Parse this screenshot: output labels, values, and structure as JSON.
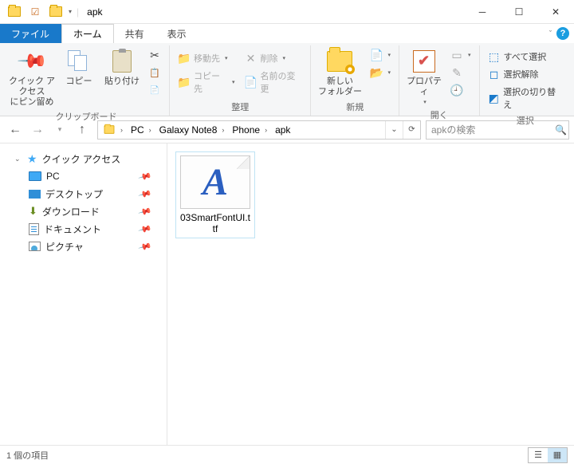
{
  "window": {
    "title": "apk"
  },
  "tabs": {
    "file": "ファイル",
    "home": "ホーム",
    "share": "共有",
    "view": "表示"
  },
  "ribbon": {
    "clipboard": {
      "label": "クリップボード",
      "pin": "クイック アクセス\nにピン留め",
      "copy": "コピー",
      "paste": "貼り付け"
    },
    "organize": {
      "label": "整理",
      "moveto": "移動先",
      "copyto": "コピー先",
      "delete": "削除",
      "rename": "名前の変更"
    },
    "new": {
      "label": "新規",
      "newfolder": "新しい\nフォルダー"
    },
    "open": {
      "label": "開く",
      "properties": "プロパティ"
    },
    "select": {
      "label": "選択",
      "all": "すべて選択",
      "none": "選択解除",
      "invert": "選択の切り替え"
    }
  },
  "breadcrumb": [
    "PC",
    "Galaxy Note8",
    "Phone",
    "apk"
  ],
  "search": {
    "placeholder": "apkの検索"
  },
  "sidebar": {
    "quick": "クイック アクセス",
    "items": [
      {
        "label": "PC"
      },
      {
        "label": "デスクトップ"
      },
      {
        "label": "ダウンロード"
      },
      {
        "label": "ドキュメント"
      },
      {
        "label": "ピクチャ"
      }
    ]
  },
  "files": [
    {
      "name": "03SmartFontUI.ttf"
    }
  ],
  "status": {
    "count": "1 個の項目"
  }
}
